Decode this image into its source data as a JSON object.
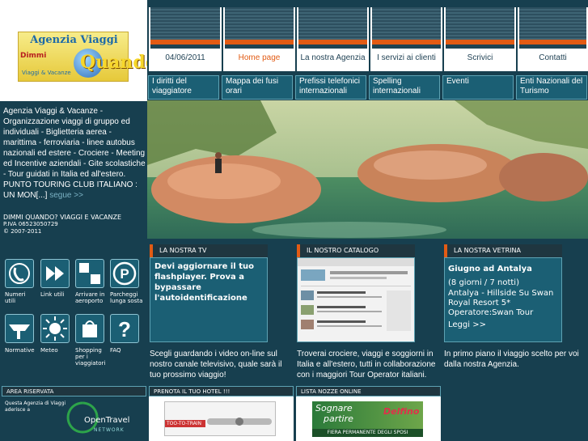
{
  "logo": {
    "title": "Agenzia Viaggi",
    "sub": "Dimmi",
    "q": "Quando?",
    "tail": "Viaggi & Vacanze"
  },
  "nav": {
    "date": "04/06/2011",
    "items": [
      "Home page",
      "La nostra Agenzia",
      "I servizi ai clienti",
      "Scrivici",
      "Contatti"
    ]
  },
  "subnav": [
    "I diritti del viaggiatore",
    "Mappa dei fusi orari",
    "Prefissi telefonici internazionali",
    "Spelling internazionali",
    "Eventi",
    "Enti Nazionali del Turismo"
  ],
  "left": {
    "text": "Agenzia Viaggi & Vacanze - Organizzazione viaggi di gruppo ed individuali - Biglietteria aerea - marittima - ferroviaria - linee autobus nazionali ed estere - Crociere - Meeting ed Incentive aziendali - Gite scolastiche - Tour guidati in Italia ed all'estero. PUNTO TOURING CLUB ITALIANO : UN MON[...]",
    "more": "segue >>",
    "company": "DIMMI QUANDO? VIAGGI E VACANZE",
    "piva": "P.IVA 06523050729",
    "copyright": "© 2007-2011"
  },
  "icons": [
    {
      "label": "Numeri utili"
    },
    {
      "label": "Link utili"
    },
    {
      "label": "Arrivare in aeroporto"
    },
    {
      "label": "Parcheggi lunga sosta"
    },
    {
      "label": "Normative"
    },
    {
      "label": "Meteo"
    },
    {
      "label": "Shopping per i viaggiatori"
    },
    {
      "label": "FAQ"
    }
  ],
  "tv": {
    "tab": "LA NOSTRA TV",
    "message": "Devi aggiornare il tuo flashplayer. Prova a bypassare l'autoidentificazione",
    "desc": "Scegli guardando i video on-line sul nostro canale televisivo, quale sarà il tuo prossimo viaggio!"
  },
  "catalogo": {
    "tab": "IL NOSTRO CATALOGO",
    "desc": "Troverai crociere, viaggi e soggiorni in Italia e all'estero, tutti in collaborazione con i maggiori Tour Operator italiani."
  },
  "vetrina": {
    "tab": "LA NOSTRA VETRINA",
    "title": "Giugno ad Antalya",
    "details": "(8 giorni / 7 notti)",
    "hotel": "Antalya - Hillside Su Swan Royal Resort 5*",
    "operator": "Operatore:Swan Tour",
    "more": "Leggi >>",
    "desc": "In primo piano il viaggio scelto per voi dalla nostra Agenzia."
  },
  "bottom": {
    "area": "AREA RISERVATA",
    "hotel": "PRENOTA IL TUO HOTEL !!!",
    "nozze": "LISTA NOZZE ONLINE",
    "adherence": "Questa Agenzia di Viaggi aderisce a",
    "opentravel": "OpenTravel",
    "network": "NETWORK",
    "train": "TOO-TO-TRAIN",
    "sognare": "Sognare",
    "partire": "partire",
    "delfino": "Delfino",
    "fiera": "FIERA PERMANENTE DEGLI SPOSI"
  },
  "colors": {
    "background": "#173f4f",
    "accent": "#e25b14",
    "panel": "#1b5f74"
  }
}
